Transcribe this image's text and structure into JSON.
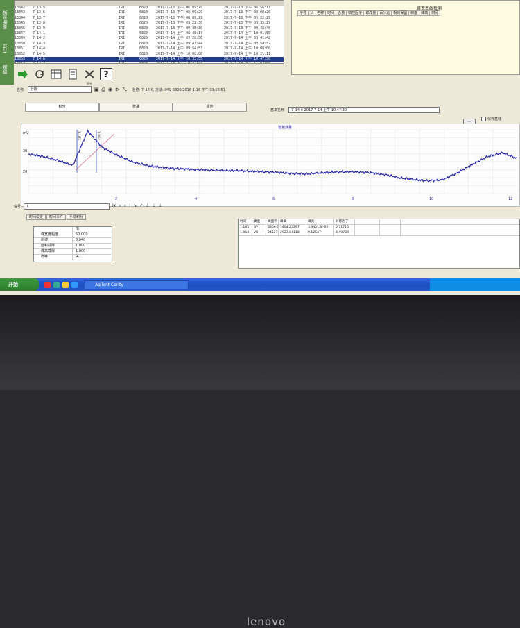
{
  "side_tabs": [
    "重新处理",
    "方法",
    "数据"
  ],
  "run_list": {
    "rows": [
      {
        "id": "13842",
        "name": "7_13-5",
        "det": "IRI",
        "mark": "6820",
        "start": "2017-7-13 下午 06:09:19",
        "end": "2017-7-13 下午 06:56:11"
      },
      {
        "id": "13843",
        "name": "7_13-6",
        "det": "IRI",
        "mark": "6820",
        "start": "2017-7-13 下午 08:09:29",
        "end": "2017-7-13 下午 08:08:20"
      },
      {
        "id": "13844",
        "name": "7_13-7",
        "det": "IRI",
        "mark": "6820",
        "start": "2017-7-13 下午 08:09:29",
        "end": "2017-7-13 下午 09:22:29"
      },
      {
        "id": "13845",
        "name": "7_13-8",
        "det": "IRI",
        "mark": "6820",
        "start": "2017-7-13 下午 09:22:30",
        "end": "2017-7-13 下午 09:35:29"
      },
      {
        "id": "13846",
        "name": "7_13-9",
        "det": "IRI",
        "mark": "6820",
        "start": "2017-7-13 下午 09:35:30",
        "end": "2017-7-13 下午 09:48:46"
      },
      {
        "id": "13847",
        "name": "7_14-1",
        "det": "IRI",
        "mark": "6820",
        "start": "2017-7-14 上午 08:48:17",
        "end": "2017-7-14 上午 10:01:55"
      },
      {
        "id": "13849",
        "name": "7_14-2",
        "det": "IRI",
        "mark": "6820",
        "start": "2017-7-14 上午 09:28:56",
        "end": "2017-7-14 上午 09:41:42"
      },
      {
        "id": "13850",
        "name": "7_14-3",
        "det": "IRI",
        "mark": "6820",
        "start": "2017-7-14 上午 09:41:44",
        "end": "2017-7-14 上午 09:54:52"
      },
      {
        "id": "13851",
        "name": "7_14-4",
        "det": "IRI",
        "mark": "6820",
        "start": "2017-7-14 上午 09:54:53",
        "end": "2017-7-14 上午 10:08:00"
      },
      {
        "id": "13852",
        "name": "7_14-5",
        "det": "IRI",
        "mark": "6820",
        "start": "2017-7-14 上午 10:08:06",
        "end": "2017-7-14 上午 10:21:11"
      },
      {
        "id": "13853",
        "name": "7_14-6",
        "det": "IRI",
        "mark": "6820",
        "start": "2017-7-14 上午 10:33:55",
        "end": "2017-7-14 上午 10:47:30"
      },
      {
        "id": "13854",
        "name": "7_14-7",
        "det": "IRI",
        "mark": "6820",
        "start": "2017-7-14 上午 10:47:34",
        "end": "2017-7-14 上午 11:02:09"
      },
      {
        "id": "13856",
        "name": "7_14-8",
        "det": "IRI",
        "mark": "6820",
        "start": "2017-7-14 上午 11:22:18",
        "end": "2017-7-14 上午 11:35:27"
      }
    ],
    "selected_index": 10
  },
  "conditions_panel": {
    "title": "峰宽基线检测",
    "headers": [
      "序号",
      "1t",
      "名称",
      "时间",
      "含量",
      "响应因子",
      "修改量",
      "百分比",
      "相对保留",
      "峰面",
      "峰高",
      "时间"
    ]
  },
  "toolbar": {
    "help": "?",
    "integrate_label": "积分"
  },
  "name_bar": {
    "name_label": "名称:",
    "name_value": "分析",
    "sample_info": "名称: 7_14-6, 方法: IMS_6820/2016-1-15 下午 03:56:51"
  },
  "view_tabs": [
    "积分",
    "校准",
    "报告"
  ],
  "sample": {
    "label": "基本名称",
    "value": "7_14-6    2017-7-14 上午 10:47:30"
  },
  "dots_button": "...",
  "save_checkbox": "保存基线",
  "chart_data": {
    "type": "line",
    "title": "箱包测量",
    "x_ticks": [
      "2",
      "4",
      "6",
      "8",
      "10",
      "12"
    ],
    "y_label": "mV",
    "y_ticks": [
      "30",
      "20"
    ],
    "markers": [
      "1.185",
      "1.964"
    ],
    "series": [
      {
        "values": [
          0.62,
          0.58,
          0.52,
          0.44,
          0.98,
          0.72,
          0.6,
          0.5,
          0.44,
          0.41,
          0.39,
          0.38,
          0.37,
          0.36,
          0.36,
          0.35,
          0.34,
          0.33,
          0.31,
          0.31,
          0.33,
          0.34,
          0.34,
          0.33,
          0.3,
          0.25,
          0.22,
          0.2,
          0.22,
          0.33,
          0.46,
          0.58,
          0.64,
          0.55
        ]
      }
    ],
    "color": "#2a2aa8"
  },
  "lower": {
    "signal_label": "信号",
    "signal_value": "1",
    "tools": [
      "Ix",
      "⌕",
      "⌕",
      "|",
      "↘",
      "↗",
      "⊥",
      "⊥",
      "⊥"
    ],
    "sub_tabs": [
      "时间设定",
      "时间事件",
      "手动积分"
    ],
    "params": [
      {
        "name": "",
        "value": "值"
      },
      {
        "name": "峰宽度幅度",
        "value": "50.000"
      },
      {
        "name": "斜坡",
        "value": "0.040"
      },
      {
        "name": "面积截除",
        "value": "1.000"
      },
      {
        "name": "峰高截除",
        "value": "1.000"
      },
      {
        "name": "肩峰",
        "value": "关"
      }
    ],
    "peaks": {
      "headers": [
        "时间",
        "类型",
        "峰面积",
        "峰高",
        "峰宽",
        "对称因子",
        "",
        ""
      ],
      "rows": [
        [
          "1.185",
          "BV",
          "3366.99398",
          "1464.23297",
          "3.9401SE-02",
          "0.71716",
          "",
          ""
        ],
        [
          "1.964",
          "VB",
          "24527.91596",
          "2923.84118",
          "0.12647",
          "4.49734",
          "",
          ""
        ]
      ]
    }
  },
  "taskbar": {
    "start": "开始",
    "task": "Agilent Cerity"
  }
}
